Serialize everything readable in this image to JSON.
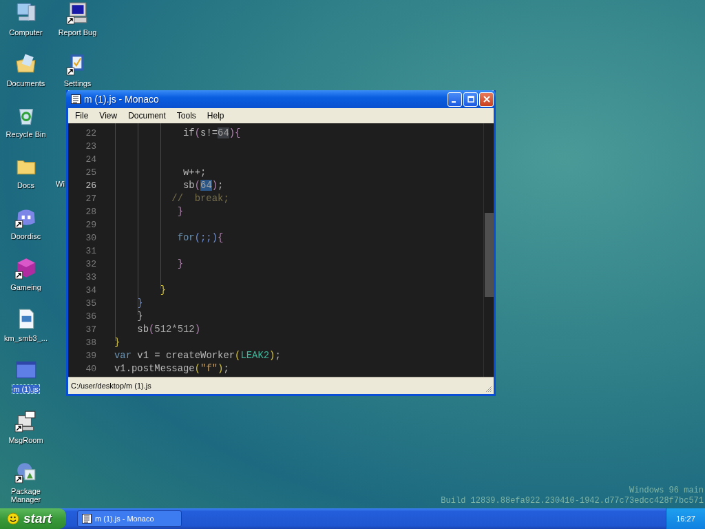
{
  "desktop": {
    "icons": [
      {
        "label": "Computer",
        "kind": "computer",
        "shortcut": false,
        "selected": false
      },
      {
        "label": "Documents",
        "kind": "documents",
        "shortcut": false,
        "selected": false
      },
      {
        "label": "Recycle Bin",
        "kind": "recycle",
        "shortcut": false,
        "selected": false
      },
      {
        "label": "Docs",
        "kind": "folder",
        "shortcut": false,
        "selected": false
      },
      {
        "label": "Doordisc",
        "kind": "chat",
        "shortcut": true,
        "selected": false
      },
      {
        "label": "Gameing",
        "kind": "cube",
        "shortcut": true,
        "selected": false
      },
      {
        "label": "km_smb3_...",
        "kind": "file",
        "shortcut": false,
        "selected": false
      },
      {
        "label": "m (1).js",
        "kind": "window",
        "shortcut": false,
        "selected": true
      },
      {
        "label": "MsgRoom",
        "kind": "messenger",
        "shortcut": true,
        "selected": false
      },
      {
        "label": "Package Manager",
        "kind": "package",
        "shortcut": true,
        "selected": false
      },
      {
        "label": "Report Bug",
        "kind": "monitor",
        "shortcut": true,
        "selected": false
      },
      {
        "label": "Settings",
        "kind": "settings",
        "shortcut": true,
        "selected": false
      }
    ],
    "partial_label": "Wi",
    "build_info": [
      "Windows 96 main",
      "Build 12839.88efa922.230410-1942.d77c73edcc428f7bc571"
    ]
  },
  "window": {
    "title": "m (1).js - Monaco",
    "menu": [
      "File",
      "View",
      "Document",
      "Tools",
      "Help"
    ],
    "editor": {
      "lines": [
        {
          "number": "22",
          "current": false,
          "tokens": [
            {
              "text": "            if",
              "kind": "plain",
              "highlighted": false
            },
            {
              "text": "(",
              "kind": "bracket2",
              "highlighted": false
            },
            {
              "text": "s!=",
              "kind": "plain",
              "highlighted": false
            },
            {
              "text": "64",
              "kind": "number",
              "highlighted": true
            },
            {
              "text": "){",
              "kind": "bracket2",
              "highlighted": false
            }
          ]
        },
        {
          "number": "23",
          "current": false
        },
        {
          "number": "24",
          "current": false
        },
        {
          "number": "25",
          "current": false,
          "tokens": [
            {
              "text": "            w++;",
              "kind": "plain"
            }
          ]
        },
        {
          "number": "26",
          "current": true,
          "tokens": [
            {
              "text": "            sb",
              "kind": "plain",
              "selected": false
            },
            {
              "text": "(",
              "kind": "bracket2",
              "selected": false
            },
            {
              "text": "64",
              "kind": "number",
              "selected": true
            },
            {
              "text": ")",
              "kind": "bracket2",
              "selected": false
            },
            {
              "text": ";",
              "kind": "plain",
              "selected": false
            }
          ]
        },
        {
          "number": "27",
          "current": false,
          "tokens": [
            {
              "text": "          //  break;",
              "kind": "comment"
            }
          ]
        },
        {
          "number": "28",
          "current": false,
          "tokens": [
            {
              "text": "           }",
              "kind": "bracket2"
            }
          ]
        },
        {
          "number": "29",
          "current": false
        },
        {
          "number": "30",
          "current": false,
          "tokens": [
            {
              "text": "           for",
              "kind": "keyword"
            },
            {
              "text": "(;;)",
              "kind": "bracket3"
            },
            {
              "text": "{",
              "kind": "bracket2"
            }
          ]
        },
        {
          "number": "31",
          "current": false
        },
        {
          "number": "32",
          "current": false,
          "tokens": [
            {
              "text": "           }",
              "kind": "bracket2"
            }
          ]
        },
        {
          "number": "33",
          "current": false
        },
        {
          "number": "34",
          "current": false,
          "tokens": [
            {
              "text": "        }",
              "kind": "bracket1"
            }
          ]
        },
        {
          "number": "35",
          "current": false,
          "tokens": [
            {
              "text": "    }",
              "kind": "bracket3"
            }
          ]
        },
        {
          "number": "36",
          "current": false,
          "tokens": [
            {
              "text": "    }",
              "kind": "plain"
            }
          ]
        },
        {
          "number": "37",
          "current": false,
          "tokens": [
            {
              "text": "    sb",
              "kind": "plain"
            },
            {
              "text": "(",
              "kind": "bracket2"
            },
            {
              "text": "512*512",
              "kind": "number"
            },
            {
              "text": ")",
              "kind": "bracket2"
            }
          ]
        },
        {
          "number": "38",
          "current": false,
          "tokens": [
            {
              "text": "}",
              "kind": "bracket1"
            }
          ]
        },
        {
          "number": "39",
          "current": false,
          "tokens": [
            {
              "text": "var",
              "kind": "keyword"
            },
            {
              "text": " v1 = createWorker",
              "kind": "plain"
            },
            {
              "text": "(",
              "kind": "bracket1"
            },
            {
              "text": "LEAK2",
              "kind": "constant"
            },
            {
              "text": ")",
              "kind": "bracket1"
            },
            {
              "text": ";",
              "kind": "plain"
            }
          ]
        },
        {
          "number": "40",
          "current": false,
          "tokens": [
            {
              "text": "v1.postMessage",
              "kind": "plain"
            },
            {
              "text": "(",
              "kind": "bracket1"
            },
            {
              "text": "\"f\"",
              "kind": "string"
            },
            {
              "text": ")",
              "kind": "bracket1"
            },
            {
              "text": ";",
              "kind": "plain"
            }
          ]
        }
      ]
    },
    "status_bar": "C:/user/desktop/m (1).js"
  },
  "taskbar": {
    "start": "start",
    "tasks": [
      {
        "label": "m (1).js - Monaco",
        "selected": false
      }
    ],
    "clock": "16:27"
  }
}
